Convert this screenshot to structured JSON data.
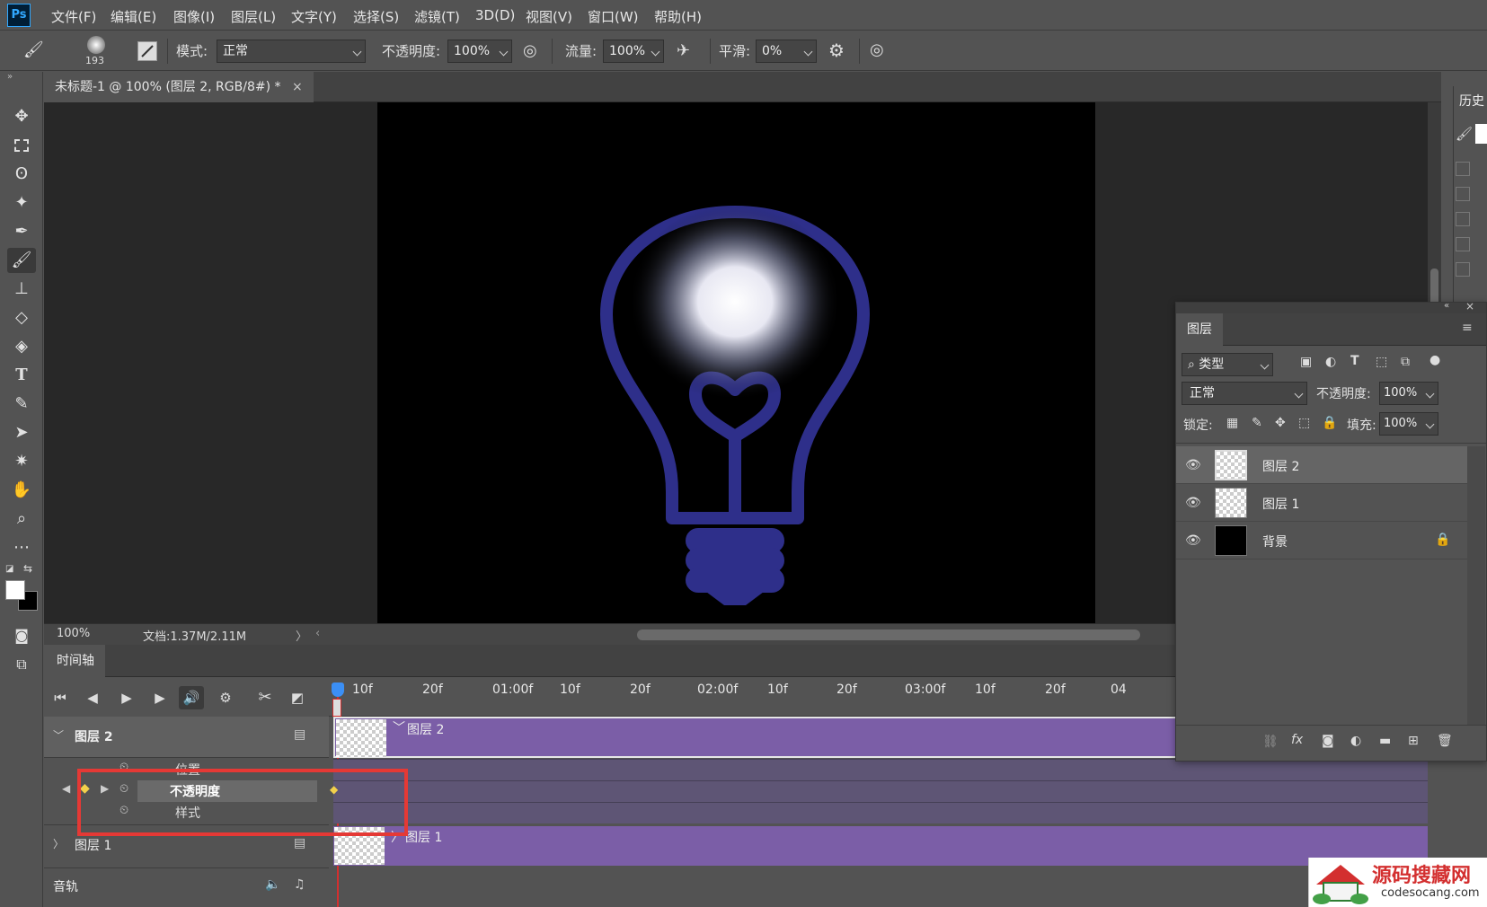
{
  "app": {
    "logo": "Ps"
  },
  "menu": [
    "文件(F)",
    "编辑(E)",
    "图像(I)",
    "图层(L)",
    "文字(Y)",
    "选择(S)",
    "滤镜(T)",
    "3D(D)",
    "视图(V)",
    "窗口(W)",
    "帮助(H)"
  ],
  "options": {
    "brush_size": "193",
    "mode_label": "模式:",
    "mode_value": "正常",
    "opacity_label": "不透明度:",
    "opacity_value": "100%",
    "flow_label": "流量:",
    "flow_value": "100%",
    "smooth_label": "平滑:",
    "smooth_value": "0%"
  },
  "document": {
    "tab_title": "未标题-1 @ 100% (图层 2, RGB/8#) *",
    "close_glyph": "×",
    "zoom": "100%",
    "doc_info": "文档:1.37M/2.11M",
    "status_arrow": "〉",
    "status_back": "‹"
  },
  "timeline": {
    "tab": "时间轴",
    "ruler": [
      "10f",
      "20f",
      "01:00f",
      "10f",
      "20f",
      "02:00f",
      "10f",
      "20f",
      "03:00f",
      "10f",
      "20f",
      "04"
    ],
    "layer2_name": "图层 2",
    "layer1_name": "图层 1",
    "audio_label": "音轨",
    "prop_position": "位置",
    "prop_opacity": "不透明度",
    "prop_style": "样式",
    "track_layer2": "图层 2",
    "track_layer1": "图层 1"
  },
  "layers_panel": {
    "title": "图层",
    "filter_kind": "类型",
    "blend_mode": "正常",
    "opacity_label": "不透明度:",
    "opacity_value": "100%",
    "lock_label": "锁定:",
    "fill_label": "填充:",
    "fill_value": "100%",
    "layers": [
      {
        "name": "图层 2",
        "selected": true
      },
      {
        "name": "图层 1",
        "selected": false
      },
      {
        "name": "背景",
        "selected": false,
        "locked": true
      }
    ]
  },
  "history_panel": {
    "title": "历史"
  },
  "watermark": {
    "title": "源码搜藏网",
    "url": "codesocang.com"
  },
  "colors": {
    "track_purple": "#7b5ea7",
    "highlight_red": "#e53935",
    "bulb_blue": "#2e2f8a",
    "playhead_blue": "#3b8ff5"
  }
}
